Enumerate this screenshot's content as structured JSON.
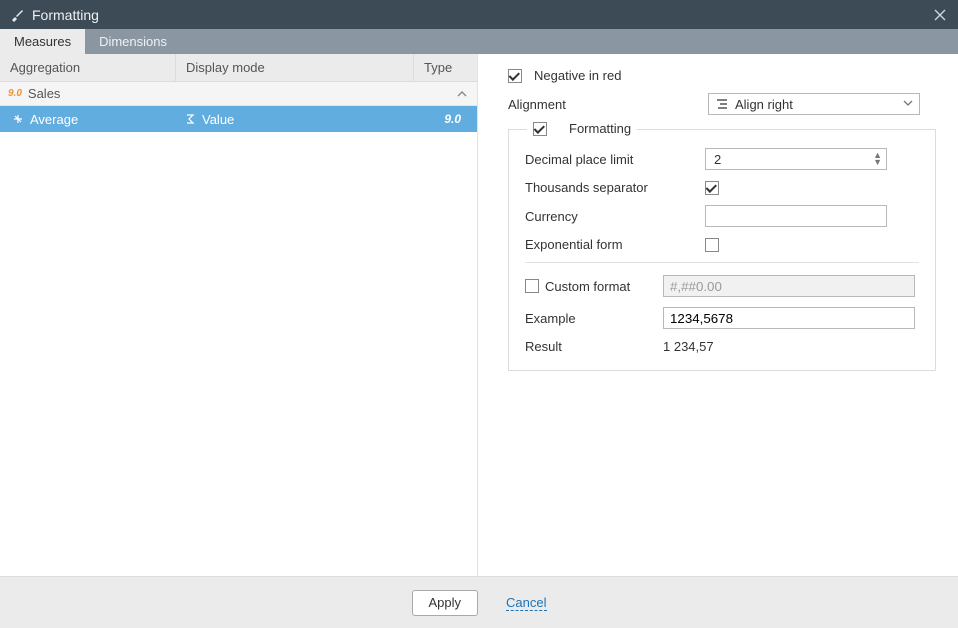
{
  "window": {
    "title": "Formatting"
  },
  "tabs": {
    "measures": "Measures",
    "dimensions": "Dimensions"
  },
  "table": {
    "headers": {
      "aggregation": "Aggregation",
      "display_mode": "Display mode",
      "type": "Type"
    },
    "group": {
      "icon": "9.0",
      "name": "Sales"
    },
    "rows": [
      {
        "aggregation": "Average",
        "display_mode": "Value",
        "type": "9.0"
      }
    ]
  },
  "panel": {
    "negative_in_red": {
      "label": "Negative in red",
      "checked": true
    },
    "alignment": {
      "label": "Alignment",
      "value": "Align right"
    },
    "group_label": "Formatting",
    "group_checked": true,
    "decimal_limit": {
      "label": "Decimal place limit",
      "value": "2"
    },
    "thousands": {
      "label": "Thousands separator",
      "checked": true
    },
    "currency": {
      "label": "Currency",
      "value": ""
    },
    "exponential": {
      "label": "Exponential form",
      "checked": false
    },
    "custom_format": {
      "label": "Custom format",
      "checked": false,
      "value": "#,##0.00"
    },
    "example": {
      "label": "Example",
      "value": "1234,5678"
    },
    "result": {
      "label": "Result",
      "value": "1 234,57"
    }
  },
  "footer": {
    "apply": "Apply",
    "cancel": "Cancel"
  }
}
